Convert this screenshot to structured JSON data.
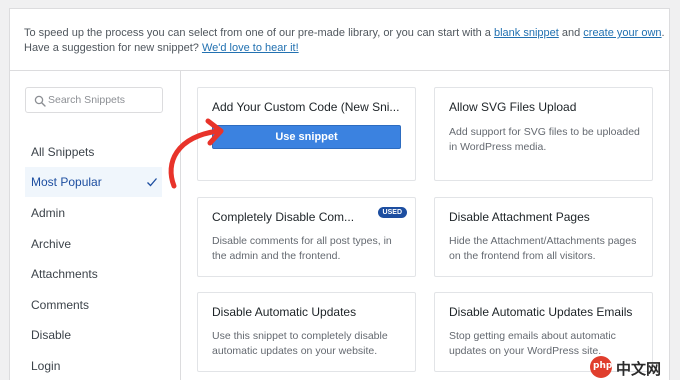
{
  "intro": {
    "line1_pre": "To speed up the process you can select from one of our pre-made library, or you can start with a ",
    "blank_snippet_link": "blank snippet",
    "and": " and ",
    "create_link": "create your own",
    "line1_post": ".",
    "line2_pre": "Have a suggestion for new snippet? ",
    "suggest_link": "We'd love to hear it!"
  },
  "sidebar": {
    "search_placeholder": "Search Snippets",
    "categories": [
      "All Snippets",
      "Most Popular",
      "Admin",
      "Archive",
      "Attachments",
      "Comments",
      "Disable",
      "Login"
    ],
    "active_index": 1
  },
  "snippets": [
    {
      "title": "Add Your Custom Code (New Sni...",
      "button": "Use snippet"
    },
    {
      "title": "Allow SVG Files Upload",
      "description": "Add support for SVG files to be uploaded in WordPress media."
    },
    {
      "title": "Completely Disable Com...",
      "badge": "USED",
      "description": "Disable comments for all post types, in the admin and the frontend."
    },
    {
      "title": "Disable Attachment Pages",
      "description": "Hide the Attachment/Attachments pages on the frontend from all visitors."
    },
    {
      "title": "Disable Automatic Updates",
      "description": "Use this snippet to completely disable automatic updates on your website."
    },
    {
      "title": "Disable Automatic Updates Emails",
      "description": "Stop getting emails about automatic updates on your WordPress site."
    }
  ],
  "watermark": {
    "logo_text": "php",
    "site_text": "中文网"
  },
  "colors": {
    "accent": "#2271b1",
    "button": "#3b82e0",
    "active_bg": "#f0f6fc",
    "active_text": "#1d4ea0",
    "arrow": "#e8332a",
    "badge": "#1d4ea0"
  }
}
